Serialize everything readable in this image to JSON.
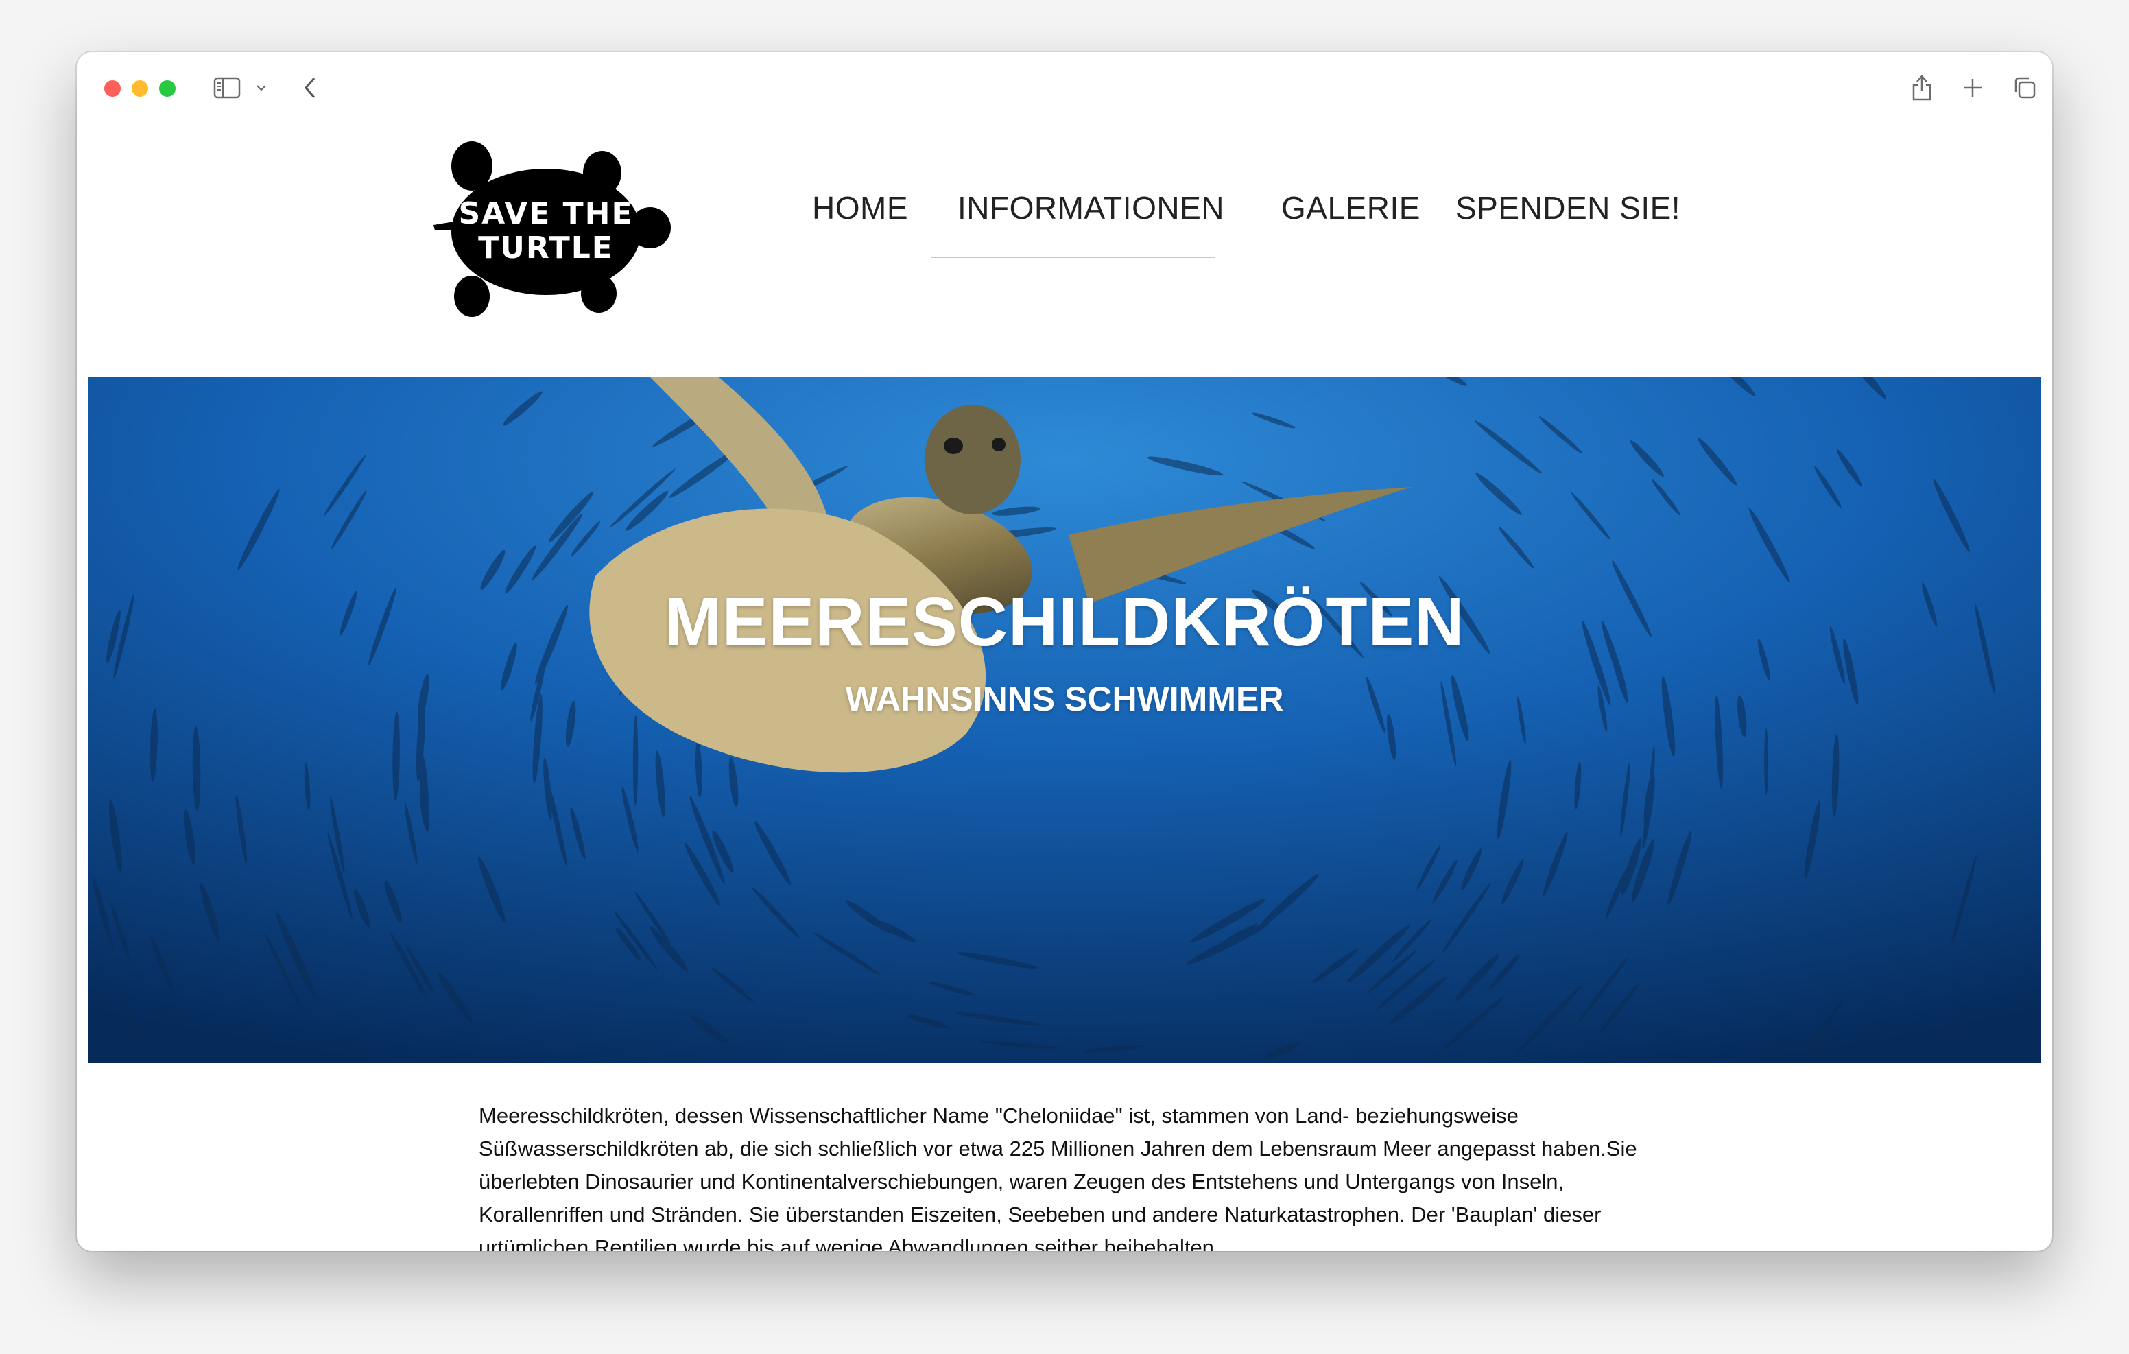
{
  "browser": {
    "icons": [
      "sidebar-icon",
      "chevron-down-icon",
      "back-icon",
      "share-icon",
      "plus-icon",
      "tabs-icon"
    ]
  },
  "site": {
    "logo_text": "SAVE THE TURTLE",
    "nav": [
      {
        "label": "HOME"
      },
      {
        "label": "INFORMATIONEN",
        "active": true
      },
      {
        "label": "GALERIE"
      },
      {
        "label": "SPENDEN SIE!"
      }
    ]
  },
  "hero": {
    "title": "MEERESCHILDKRÖTEN",
    "subtitle": "WAHNSINNS SCHWIMMER"
  },
  "content": {
    "paragraph": "Meeresschildkröten, dessen Wissenschaftlicher Name \"Cheloniidae\" ist, stammen von Land- beziehungsweise Süßwasserschildkröten ab, die sich schließlich vor etwa 225 Millionen Jahren dem Lebensraum Meer angepasst haben.Sie überlebten Dinosaurier und Kontinentalverschiebungen, waren Zeugen des Entstehens und Untergangs von Inseln, Korallenriffen und Stränden. Sie überstanden Eiszeiten, Seebeben und andere Naturkatastrophen. Der 'Bauplan' dieser urtümlichen Reptilien wurde bis auf wenige Abwandlungen seither beibehalten."
  },
  "colors": {
    "close": "#fe5f57",
    "minimize": "#febc2e",
    "zoom": "#28c840",
    "ocean": "#0a3d7a"
  }
}
